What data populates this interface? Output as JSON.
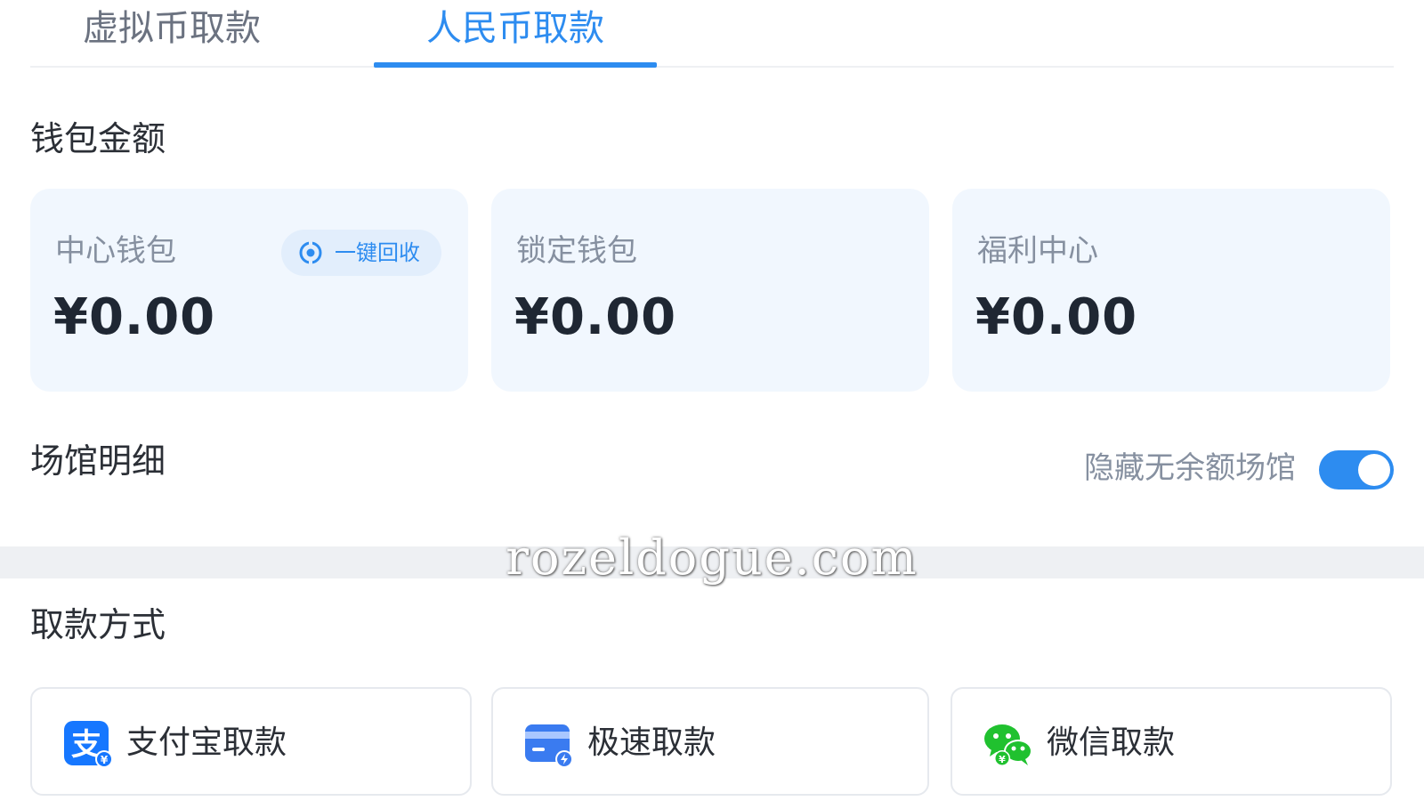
{
  "tabs": [
    {
      "label": "虚拟币取款",
      "active": false
    },
    {
      "label": "人民币取款",
      "active": true
    }
  ],
  "wallet_section": {
    "title": "钱包金额",
    "cards": [
      {
        "name": "中心钱包",
        "amount": "¥0.00"
      },
      {
        "name": "锁定钱包",
        "amount": "¥0.00"
      },
      {
        "name": "福利中心",
        "amount": "¥0.00"
      }
    ],
    "recycle_label": "一键回收"
  },
  "venue_section": {
    "title": "场馆明细",
    "toggle_label": "隐藏无余额场馆",
    "toggle_on": true
  },
  "watermark": "rozeldogue.com",
  "methods_section": {
    "title": "取款方式",
    "methods": [
      {
        "label": "支付宝取款",
        "icon": "alipay-icon"
      },
      {
        "label": "极速取款",
        "icon": "fast-card-icon"
      },
      {
        "label": "微信取款",
        "icon": "wechat-icon"
      }
    ]
  },
  "colors": {
    "accent": "#2d8cf0",
    "card_bg": "#f1f7fe",
    "wechat_green": "#20c12f"
  }
}
